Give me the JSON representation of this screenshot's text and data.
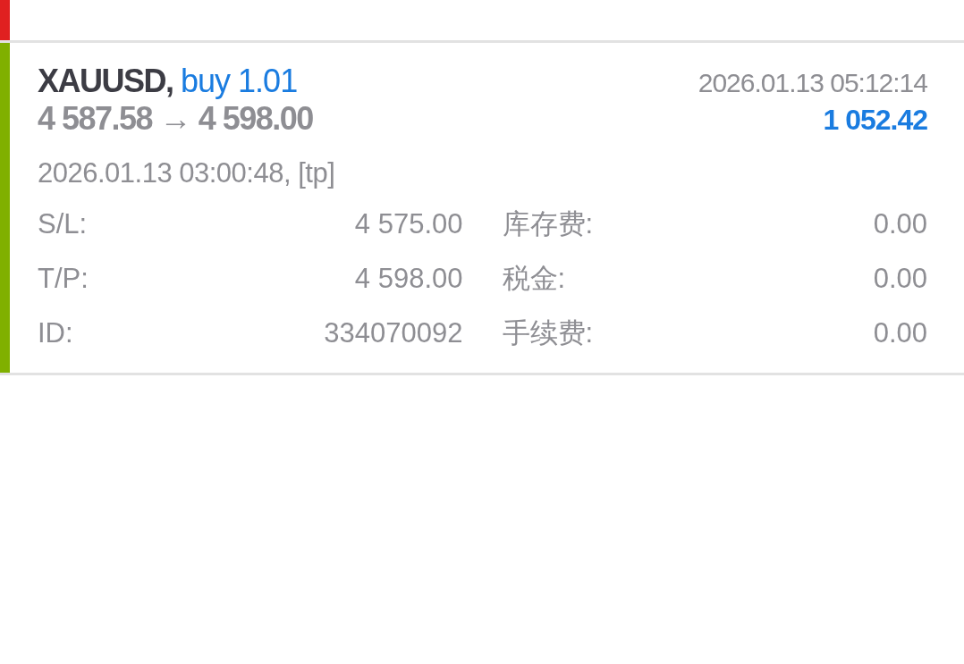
{
  "deals": [
    {
      "color": "#e02020"
    },
    {
      "color": "#80b000",
      "symbol": "XAUUSD,",
      "side": "buy 1.01",
      "prices": "4 587.58 → 4 598.00",
      "time": "2026.01.13 05:12:14",
      "profit": "1 052.42",
      "open_info": "2026.01.13 03:00:48, [tp]",
      "details": [
        {
          "label": "S/L:",
          "value": "4 575.00",
          "label2": "库存费:",
          "value2": "0.00"
        },
        {
          "label": "T/P:",
          "value": "4 598.00",
          "label2": "税金:",
          "value2": "0.00"
        },
        {
          "label": "ID:",
          "value": "334070092",
          "label2": "手续费:",
          "value2": "0.00"
        }
      ]
    }
  ]
}
